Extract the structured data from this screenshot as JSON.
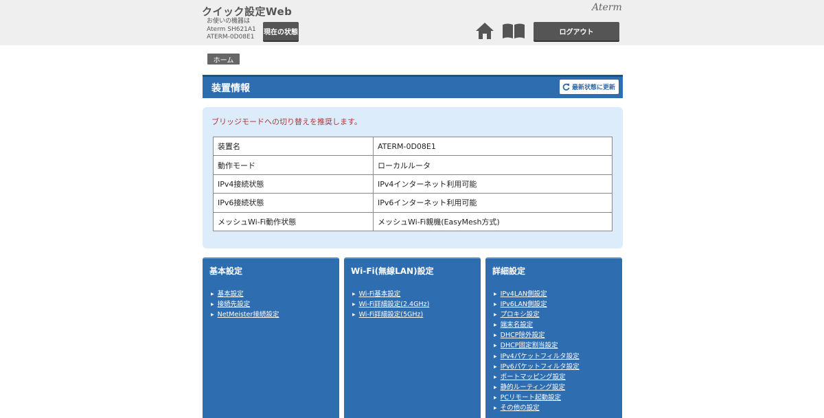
{
  "header": {
    "app_title": "クイック設定Web",
    "brand": "Aterm",
    "device_info": {
      "label": "お使いの機器は",
      "model": "Aterm SH621A1",
      "device_name": "ATERM-0D08E1"
    },
    "status_button": "現在の状態",
    "logout_button": "ログアウト",
    "icons": {
      "home": "home-icon",
      "manual": "book-icon"
    }
  },
  "breadcrumb": {
    "home": "ホーム"
  },
  "device_section": {
    "title": "装置情報",
    "refresh_button": "最新状態に更新",
    "recommendation": "ブリッジモードへの切り替えを推奨します。",
    "rows": [
      {
        "key": "装置名",
        "value": "ATERM-0D08E1"
      },
      {
        "key": "動作モード",
        "value": "ローカルルータ"
      },
      {
        "key": "IPv4接続状態",
        "value": "IPv4インターネット利用可能"
      },
      {
        "key": "IPv6接続状態",
        "value": "IPv6インターネット利用可能"
      },
      {
        "key": "メッシュWi-Fi動作状態",
        "value": "メッシュWi-Fi親機(EasyMesh方式)"
      }
    ]
  },
  "cards": [
    {
      "title": "基本設定",
      "links": [
        "基本設定",
        "接続先設定",
        "NetMeister接続設定"
      ]
    },
    {
      "title": "Wi-Fi(無線LAN)設定",
      "links": [
        "Wi-Fi基本設定",
        "Wi-Fi詳細設定(2.4GHz)",
        "Wi-Fi詳細設定(5GHz)"
      ]
    },
    {
      "title": "詳細設定",
      "links": [
        "IPv4LAN側設定",
        "IPv6LAN側設定",
        "プロキシ設定",
        "端末名設定",
        "DHCP除外設定",
        "DHCP固定割当設定",
        "IPv4パケットフィルタ設定",
        "IPv6パケットフィルタ設定",
        "ポートマッピング設定",
        "静的ルーティング設定",
        "PCリモート起動設定",
        "その他の設定"
      ]
    }
  ],
  "colors": {
    "primary_blue": "#2e6db0",
    "panel_bg": "#dcecfa",
    "alert_text": "#b0363c",
    "header_bg": "#efefef"
  }
}
